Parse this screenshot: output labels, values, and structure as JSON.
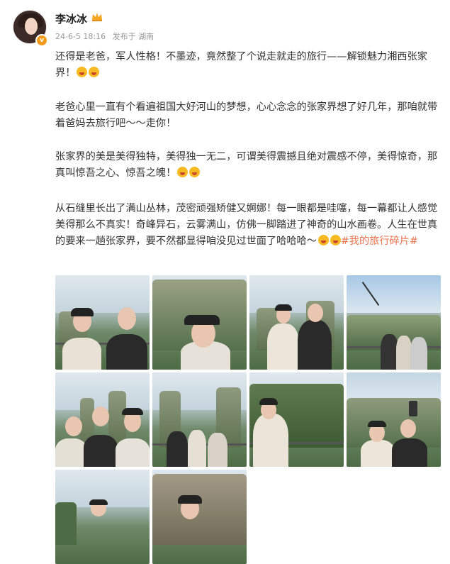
{
  "header": {
    "username": "李冰冰",
    "date": "24-6-5 18:16",
    "source": "发布于 湖南",
    "verified_badge": "v",
    "icons": [
      "crown-icon",
      "verified-badge-icon",
      "avatar"
    ]
  },
  "body": {
    "p1": "还得是老爸，军人性格！不墨迹，竟然整了个说走就走的旅行——解锁魅力湘西张家界！",
    "p2": "老爸心里一直有个看遍祖国大好河山的梦想，心心念念的张家界想了好几年，那咱就带着爸妈去旅行吧～～走你！",
    "p3": "张家界的美是美得独特，美得独一无二，可谓美得震撼且绝对震感不停，美得惊奇，那真叫惊吾之心、惊吾之魄！",
    "p4": "从石缝里长出了满山丛林，茂密顽强矫健又婀娜！每一眼都是哇噻，每一幕都让人感觉美得那么不真实！奇峰异石，云雾满山，仿佛一脚踏进了神奇的山水画卷。人生在世真的要来一趟张家界，要不然都显得咱没见过世面了哈哈哈～",
    "hashtag": "#我的旅行碎片#"
  },
  "colors": {
    "hashtag": "#eb7350",
    "meta_text": "#999999",
    "badge": "#f49a1b"
  },
  "photos": [
    "photo-1",
    "photo-2",
    "photo-3",
    "photo-4",
    "photo-5",
    "photo-6",
    "photo-7",
    "photo-8",
    "photo-9",
    "photo-10"
  ]
}
